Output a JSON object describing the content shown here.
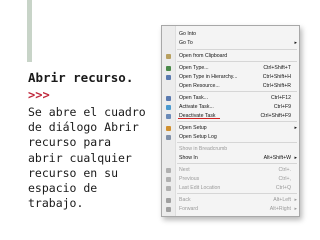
{
  "slide": {
    "title": "Abrir recurso.",
    "arrows": ">>>",
    "body_lines": [
      "Se abre el cuadro",
      "de diálogo Abrir",
      "recurso para",
      "abrir cualquier",
      "recurso en su",
      "espacio de",
      "trabajo."
    ]
  },
  "menu": {
    "items": [
      {
        "label": "Go Into",
        "shortcut": "",
        "submenu": false,
        "disabled": false,
        "icon": "none"
      },
      {
        "label": "Go To",
        "shortcut": "",
        "submenu": true,
        "disabled": false,
        "icon": "none"
      },
      {
        "label": "Open from Clipboard",
        "shortcut": "",
        "submenu": false,
        "disabled": false,
        "icon": "clipboard-icon"
      },
      {
        "label": "Open Type...",
        "shortcut": "Ctrl+Shift+T",
        "submenu": false,
        "disabled": false,
        "icon": "open-type-icon"
      },
      {
        "label": "Open Type in Hierarchy...",
        "shortcut": "Ctrl+Shift+H",
        "submenu": false,
        "disabled": false,
        "icon": "type-hierarchy-icon"
      },
      {
        "label": "Open Resource...",
        "shortcut": "Ctrl+Shift+R",
        "submenu": false,
        "disabled": false,
        "icon": "none"
      },
      {
        "label": "Open Task...",
        "shortcut": "Ctrl+F12",
        "submenu": false,
        "disabled": false,
        "icon": "open-task-icon"
      },
      {
        "label": "Activate Task...",
        "shortcut": "Ctrl+F9",
        "submenu": false,
        "disabled": false,
        "icon": "activate-task-icon"
      },
      {
        "label": "Deactivate Task",
        "shortcut": "Ctrl+Shift+F9",
        "submenu": false,
        "disabled": false,
        "icon": "deactivate-task-icon"
      },
      {
        "label": "Open Setup",
        "shortcut": "",
        "submenu": true,
        "disabled": false,
        "icon": "setup-icon"
      },
      {
        "label": "Open Setup Log",
        "shortcut": "",
        "submenu": false,
        "disabled": false,
        "icon": "setup-log-icon"
      },
      {
        "label": "Show in Breadcrumb",
        "shortcut": "",
        "submenu": false,
        "disabled": true,
        "icon": "none"
      },
      {
        "label": "Show In",
        "shortcut": "Alt+Shift+W",
        "submenu": true,
        "disabled": false,
        "icon": "none"
      },
      {
        "label": "Next",
        "shortcut": "Ctrl+.",
        "submenu": false,
        "disabled": true,
        "icon": "next-icon"
      },
      {
        "label": "Previous",
        "shortcut": "Ctrl+,",
        "submenu": false,
        "disabled": true,
        "icon": "previous-icon"
      },
      {
        "label": "Last Edit Location",
        "shortcut": "Ctrl+Q",
        "submenu": false,
        "disabled": true,
        "icon": "last-edit-icon"
      },
      {
        "label": "Back",
        "shortcut": "Alt+Left",
        "submenu": true,
        "disabled": true,
        "icon": "back-icon"
      },
      {
        "label": "Forward",
        "shortcut": "Alt+Right",
        "submenu": true,
        "disabled": true,
        "icon": "forward-icon"
      }
    ],
    "highlighted_item": "Open Resource...",
    "colors": {
      "accent_red": "#c0283c",
      "underline": "#d02020"
    }
  }
}
